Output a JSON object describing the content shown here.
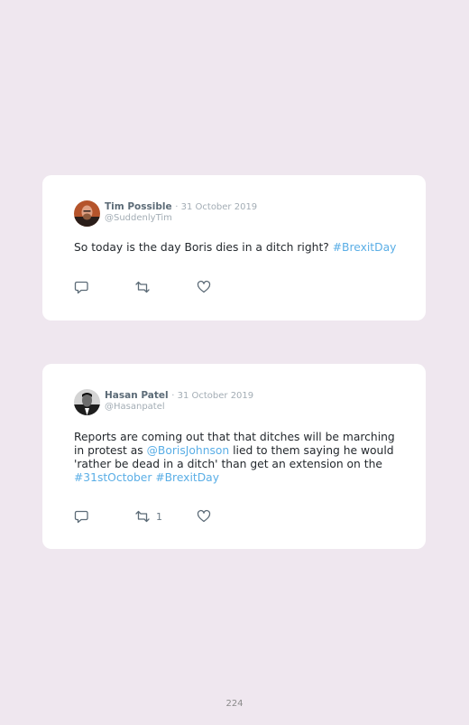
{
  "tweets": [
    {
      "author": "Tim Possible",
      "date": "· 31 October 2019",
      "handle": "@SuddenlyTim",
      "body": [
        {
          "text": "So today is the day Boris dies in a ditch right? ",
          "type": "text"
        },
        {
          "text": "#BrexitDay",
          "type": "hashtag"
        }
      ],
      "retweets": "",
      "avatar_icon": "avatar-icon"
    },
    {
      "author": "Hasan Patel",
      "date": "· 31 October 2019",
      "handle": "@Hasanpatel",
      "body": [
        {
          "text": "Reports are coming out that that ditches will be marching in protest as ",
          "type": "text"
        },
        {
          "text": "@BorisJohnson",
          "type": "mention"
        },
        {
          "text": " lied to them saying he would 'rather be dead in a ditch' than get an extension on the ",
          "type": "text"
        },
        {
          "text": "#31stOctober",
          "type": "hashtag"
        },
        {
          "text": " ",
          "type": "text"
        },
        {
          "text": "#BrexitDay",
          "type": "hashtag"
        }
      ],
      "retweets": "1",
      "avatar_icon": "avatar-icon"
    }
  ],
  "icons": {
    "reply": "reply-icon",
    "retweet": "retweet-icon",
    "like": "heart-icon"
  },
  "colors": {
    "background": "#efe7ef",
    "card": "#ffffff",
    "link": "#5aaee6",
    "muted": "#a3adb5"
  },
  "footer": {
    "page_number": "224"
  }
}
